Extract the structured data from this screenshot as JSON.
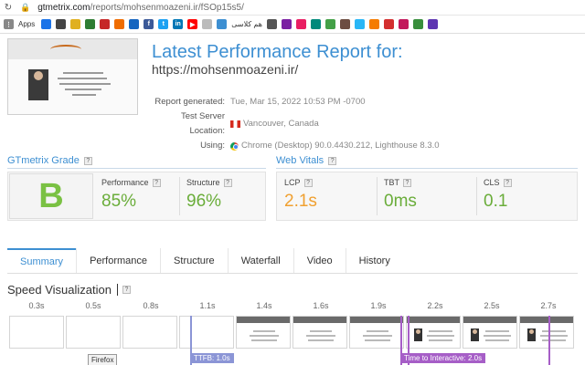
{
  "browser": {
    "url_host": "gtmetrix.com",
    "url_path": "/reports/mohsenmoazeni.ir/fSOp15s5/",
    "bookmarks_label": "Apps",
    "bookmark_text_fa": "هم کلاسی"
  },
  "report": {
    "title": "Latest Performance Report for:",
    "url": "https://mohsenmoazeni.ir/",
    "meta": [
      {
        "label": "Report generated:",
        "value": "Tue, Mar 15, 2022 10:53 PM -0700",
        "icon": ""
      },
      {
        "label": "Test Server Location:",
        "value": "Vancouver, Canada",
        "icon": "canada-flag-icon"
      },
      {
        "label": "Using:",
        "value": "Chrome (Desktop) 90.0.4430.212, Lighthouse 8.3.0",
        "icon": "chrome-icon"
      }
    ]
  },
  "grade": {
    "heading": "GTmetrix Grade",
    "help": "?",
    "letter": "B",
    "performance_label": "Performance",
    "performance_value": "85%",
    "structure_label": "Structure",
    "structure_value": "96%"
  },
  "vitals": {
    "heading": "Web Vitals",
    "help": "?",
    "lcp_label": "LCP",
    "lcp_value": "2.1s",
    "tbt_label": "TBT",
    "tbt_value": "0ms",
    "cls_label": "CLS",
    "cls_value": "0.1"
  },
  "tabs": [
    "Summary",
    "Performance",
    "Structure",
    "Waterfall",
    "Video",
    "History"
  ],
  "speed": {
    "heading": "Speed Visualization",
    "help": "?",
    "ticks": [
      "0.3s",
      "0.5s",
      "0.8s",
      "1.1s",
      "1.4s",
      "1.6s",
      "1.9s",
      "2.2s",
      "2.5s",
      "2.7s"
    ],
    "ttfb_label": "TTFB: 1.0s",
    "tti_label": "Time to Interactive: 2.0s",
    "tooltip": "Firefox"
  },
  "colors": {
    "accent": "#3d8fd2",
    "grade_green": "#7ac143",
    "value_green": "#6aad3a",
    "lcp_orange": "#f0a030",
    "ttfb": "#8b95d6",
    "tti": "#a65ec7"
  }
}
